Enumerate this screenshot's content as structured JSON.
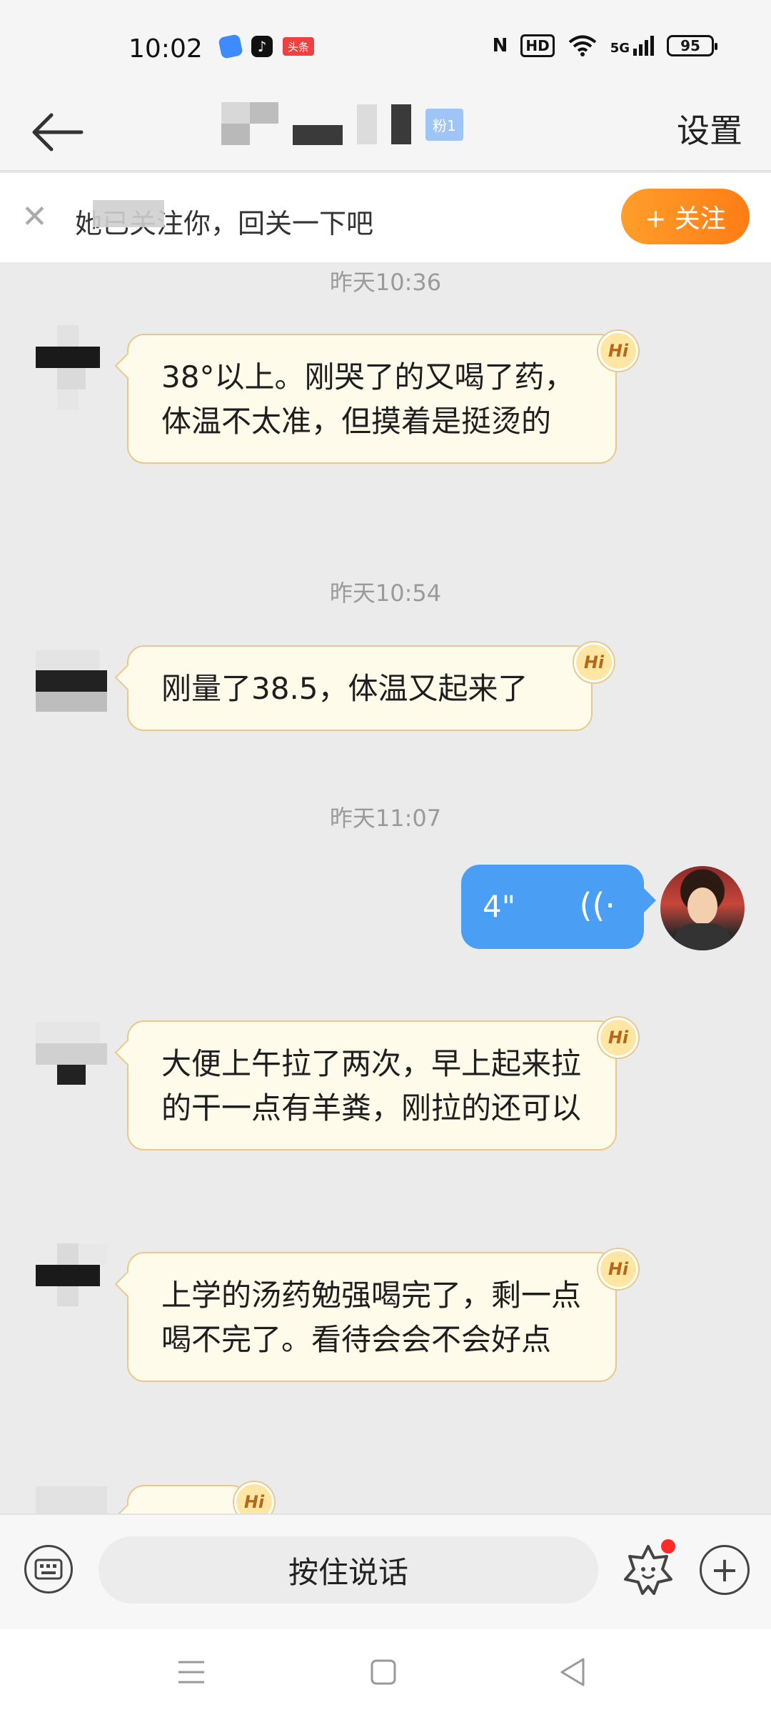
{
  "status_bar": {
    "time": "10:02",
    "apps": [
      "app-icon-blue",
      "tiktok-icon",
      "toutiao-icon"
    ],
    "toutiao_label": "头条",
    "tiktok_glyph": "♪",
    "nfc": "N",
    "hd": "HD",
    "signal": "5G",
    "battery": "95"
  },
  "header": {
    "fan_badge": "粉1",
    "settings_label": "设置"
  },
  "follow_bar": {
    "message": "她已关注你，回关一下吧",
    "button_label": "+ 关注"
  },
  "messages": [
    {
      "time": "昨天10:36",
      "text": "38°以上。刚哭了的又喝了药，体温不太准，但摸着是挺烫的"
    },
    {
      "time": "昨天10:54",
      "text": "刚量了38.5，体温又起来了"
    },
    {
      "time": "昨天11:07",
      "voice_length": "4\""
    },
    {
      "text": "大便上午拉了两次，早上起来拉的干一点有羊粪，刚拉的还可以"
    },
    {
      "text": "上学的汤药勉强喝完了，剩一点喝不完了。看待会会不会好点"
    }
  ],
  "hi_label": "Hi",
  "input_bar": {
    "hold_to_talk": "按住说话"
  },
  "colors": {
    "accent_orange": "#ff8a1f",
    "my_bubble": "#4a9ef3",
    "their_bubble": "#fffbeb"
  }
}
